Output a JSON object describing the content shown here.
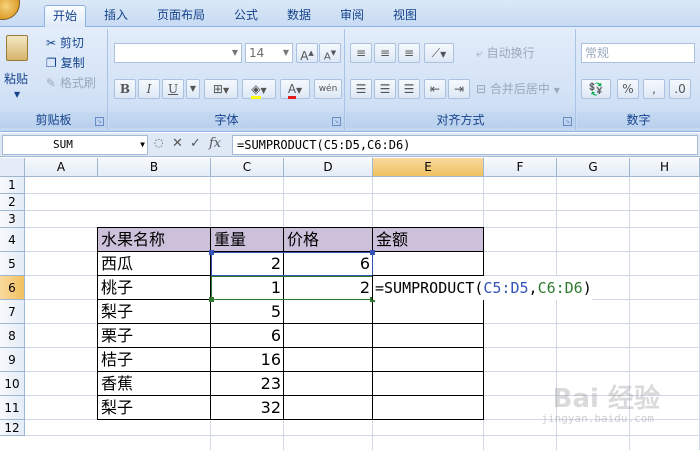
{
  "ribbon_tabs": [
    "开始",
    "插入",
    "页面布局",
    "公式",
    "数据",
    "审阅",
    "视图"
  ],
  "clipboard": {
    "paste_label": "粘贴",
    "cut_label": "剪切",
    "copy_label": "复制",
    "format_painter_label": "格式刷",
    "group_label": "剪贴板"
  },
  "font_group": {
    "font_name": "",
    "font_size": "14",
    "bold": "B",
    "italic": "I",
    "underline": "U",
    "phonetic": "wén",
    "group_label": "字体"
  },
  "alignment_group": {
    "wrap_text_label": "自动换行",
    "merge_center_label": "合并后居中",
    "group_label": "对齐方式"
  },
  "number_group": {
    "format": "常规",
    "percent": "%",
    "comma": ",",
    "group_label": "数字"
  },
  "formula_bar": {
    "name_box": "SUM",
    "fx": "fx",
    "formula": "=SUMPRODUCT(C5:D5,C6:D6)"
  },
  "columns": [
    "A",
    "B",
    "C",
    "D",
    "E",
    "F",
    "G",
    "H"
  ],
  "rows": [
    "1",
    "2",
    "3",
    "4",
    "5",
    "6",
    "7",
    "8",
    "9",
    "10",
    "11",
    "12"
  ],
  "table": {
    "headers": [
      "水果名称",
      "重量",
      "价格",
      "金额"
    ],
    "rows": [
      {
        "name": "西瓜",
        "weight": "2",
        "price": "6"
      },
      {
        "name": "桃子",
        "weight": "1",
        "price": "2"
      },
      {
        "name": "梨子",
        "weight": "5",
        "price": ""
      },
      {
        "name": "栗子",
        "weight": "6",
        "price": ""
      },
      {
        "name": "桔子",
        "weight": "16",
        "price": ""
      },
      {
        "name": "香蕉",
        "weight": "23",
        "price": ""
      },
      {
        "name": "梨子",
        "weight": "32",
        "price": ""
      }
    ]
  },
  "cell_edit": {
    "prefix": "=SUMPRODUCT(",
    "ref1": "C5:D5",
    "sep": ",",
    "ref2": "C6:D6",
    "suffix": ")"
  },
  "colors": {
    "header_fill": "#ccc0da",
    "ref_blue": "#3353b8",
    "ref_green": "#2f7a2f"
  },
  "watermark": {
    "main": "Bai 经验",
    "sub": "jingyan.baidu.com"
  }
}
